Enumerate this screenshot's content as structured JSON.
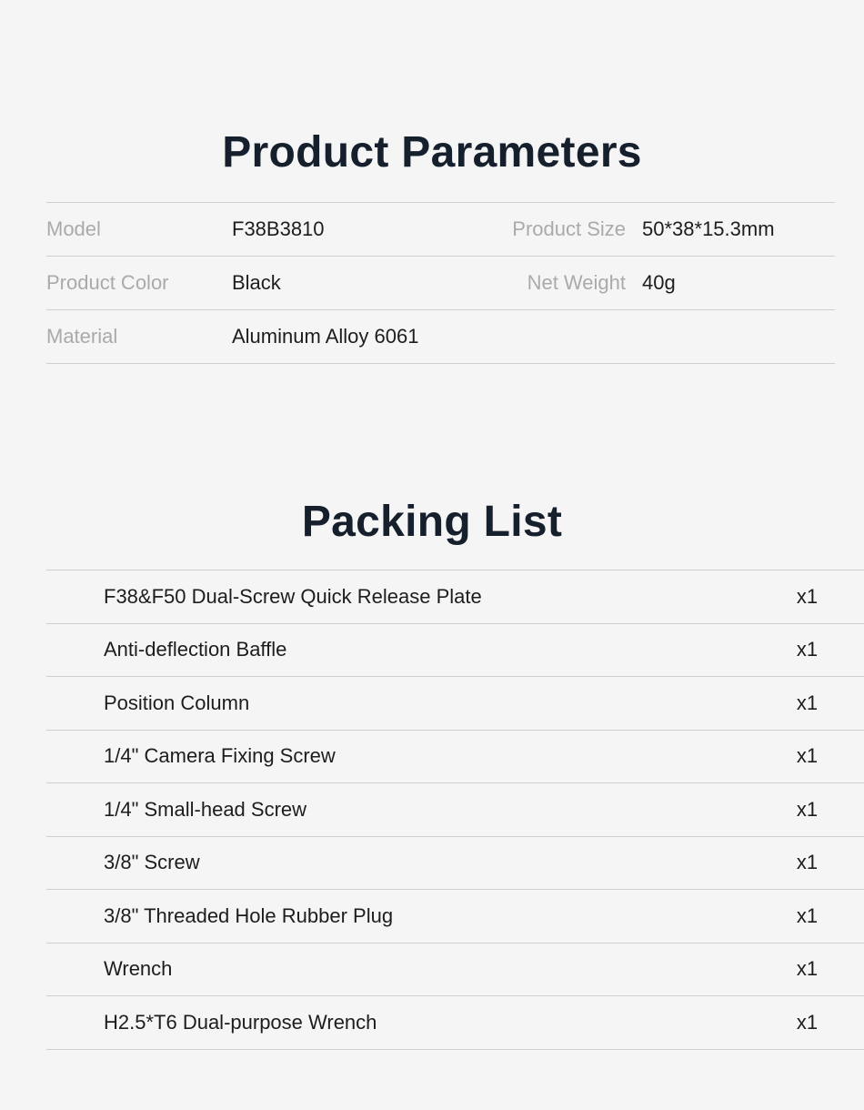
{
  "page": {
    "background_color": "#f5f5f6",
    "heading_color": "#161f2c",
    "label_color": "#aaaaac",
    "value_color": "#1d1d1f",
    "divider_color": "#cfcfd1"
  },
  "parameters_section": {
    "title": "Product Parameters",
    "rows": [
      {
        "label_left": "Model",
        "value_left": "F38B3810",
        "label_right": "Product Size",
        "value_right": "50*38*15.3mm"
      },
      {
        "label_left": "Product Color",
        "value_left": "Black",
        "label_right": "Net Weight",
        "value_right": "40g"
      },
      {
        "label_left": "Material",
        "value_left": "Aluminum Alloy 6061",
        "label_right": "",
        "value_right": ""
      }
    ]
  },
  "packing_section": {
    "title": "Packing List",
    "items": [
      {
        "name": "F38&F50 Dual-Screw Quick Release Plate",
        "qty": "x1"
      },
      {
        "name": "Anti-deflection Baffle",
        "qty": "x1"
      },
      {
        "name": "Position Column",
        "qty": "x1"
      },
      {
        "name": "1/4\" Camera Fixing Screw",
        "qty": "x1"
      },
      {
        "name": "1/4\" Small-head Screw",
        "qty": "x1"
      },
      {
        "name": "3/8\" Screw",
        "qty": "x1"
      },
      {
        "name": "3/8\" Threaded Hole Rubber Plug",
        "qty": "x1"
      },
      {
        "name": "Wrench",
        "qty": "x1"
      },
      {
        "name": "H2.5*T6 Dual-purpose Wrench",
        "qty": "x1"
      }
    ]
  }
}
